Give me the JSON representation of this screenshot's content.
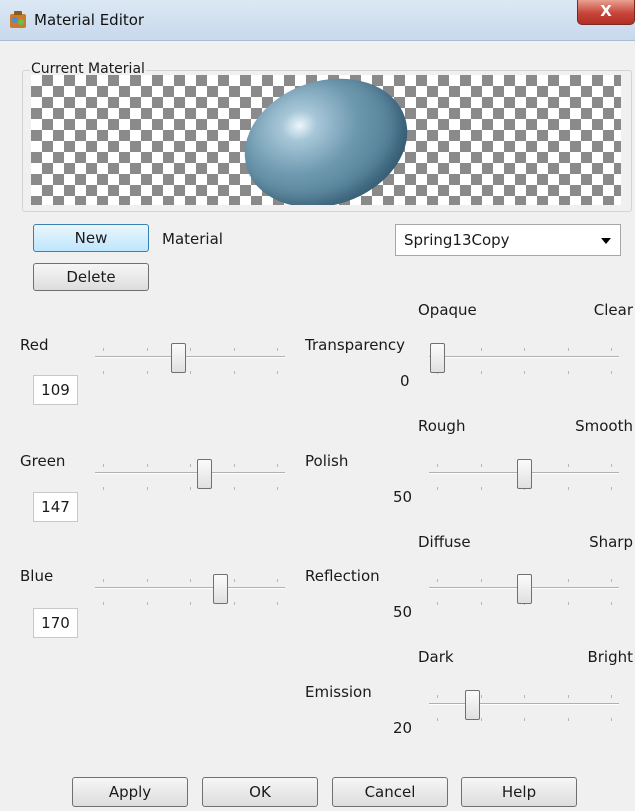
{
  "window": {
    "title": "Material Editor",
    "close_label": "X"
  },
  "preview": {
    "group_label": "Current Material"
  },
  "material_row": {
    "new_label": "New",
    "delete_label": "Delete",
    "material_label": "Material",
    "selected_material": "Spring13Copy"
  },
  "color": {
    "red": {
      "label": "Red",
      "value": "109",
      "fraction": 0.43
    },
    "green": {
      "label": "Green",
      "value": "147",
      "fraction": 0.58
    },
    "blue": {
      "label": "Blue",
      "value": "170",
      "fraction": 0.67
    }
  },
  "properties": {
    "transparency": {
      "label": "Transparency",
      "min_label": "Opaque",
      "max_label": "Clear",
      "value": "0",
      "fraction": 0.0
    },
    "polish": {
      "label": "Polish",
      "min_label": "Rough",
      "max_label": "Smooth",
      "value": "50",
      "fraction": 0.5
    },
    "reflection": {
      "label": "Reflection",
      "min_label": "Diffuse",
      "max_label": "Sharp",
      "value": "50",
      "fraction": 0.5
    },
    "emission": {
      "label": "Emission",
      "min_label": "Dark",
      "max_label": "Bright",
      "value": "20",
      "fraction": 0.2
    }
  },
  "footer": {
    "apply_label": "Apply",
    "ok_label": "OK",
    "cancel_label": "Cancel",
    "help_label": "Help"
  }
}
